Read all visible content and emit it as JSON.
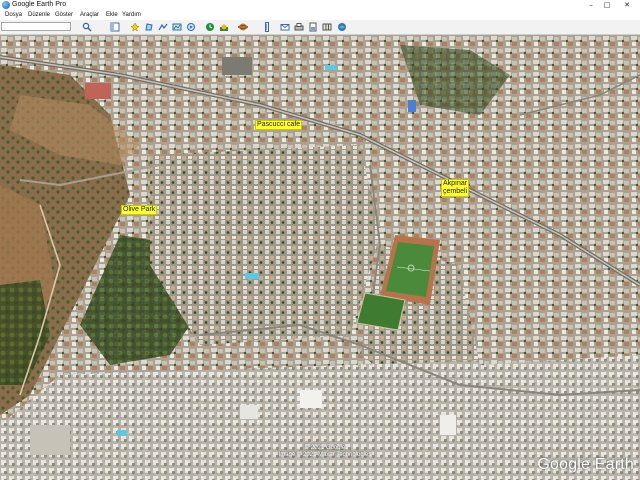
{
  "window": {
    "title": "Google Earth Pro",
    "controls": {
      "minimize": "–",
      "maximize": "□",
      "close": "✕"
    }
  },
  "menu": {
    "items": [
      {
        "label": "Dosya"
      },
      {
        "label": "Düzenle"
      },
      {
        "label": "Göster"
      },
      {
        "label": "Araçlar"
      },
      {
        "label": "Ekle"
      },
      {
        "label": "Yardım"
      }
    ]
  },
  "toolbar": {
    "search_value": "",
    "buttons": [
      "search-icon",
      "sidebar-icon",
      "placemark-icon",
      "polygon-icon",
      "path-icon",
      "image-overlay-icon",
      "tour-icon",
      "historical-imagery-icon",
      "sunlight-icon",
      "planets-icon",
      "ruler-icon",
      "email-icon",
      "print-icon",
      "save-image-icon",
      "maps-icon",
      "kml-icon"
    ]
  },
  "map": {
    "places": [
      {
        "name": "Pascucci cafe"
      },
      {
        "name": "Olive Park"
      },
      {
        "name": "Akpınar\nçembeli"
      }
    ],
    "attribution": {
      "line1": "© 2021 Google",
      "line2": "Image © 2021 Maxar Technologies"
    },
    "logo": "Google Earth"
  },
  "colors": {
    "label_bg": "#ffff33",
    "pitch_green": "#4a8a3a",
    "track": "#b5744c",
    "urban": "#b7b1a4",
    "vegetation": "#3d5a2a"
  }
}
